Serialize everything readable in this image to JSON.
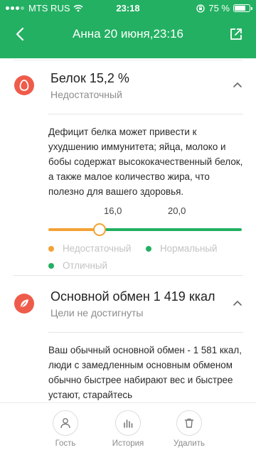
{
  "status": {
    "carrier": "MTS RUS",
    "time": "23:18",
    "battery_text": "75 %",
    "battery_level": 0.75
  },
  "nav": {
    "title": "Анна 20 июня,23:16",
    "back_icon": "chevron-left-icon",
    "share_icon": "share-icon"
  },
  "protein": {
    "title": "Белок 15,2 %",
    "status": "Недостаточный",
    "description": "Дефицит белка может привести к ухудшению иммунитета; яйца, молоко и бобы содержат высококачественный белок, а также малое количество жира, что полезно для вашего здоровья.",
    "scale_labels": [
      "16,0",
      "20,0"
    ],
    "value": 15.2,
    "legend": [
      {
        "label": "Недостаточный",
        "color": "#f3a235"
      },
      {
        "label": "Нормальный",
        "color": "#23b062"
      },
      {
        "label": "Отличный",
        "color": "#23b062"
      }
    ],
    "icon": "egg-icon"
  },
  "bmr": {
    "title": "Основной обмен 1 419 ккал",
    "status": "Цели не достигнуты",
    "description": "Ваш обычный основной обмен - 1 581 ккал, люди с замедленным основным обменом обычно быстрее набирают вес и быстрее устают, старайтесь",
    "icon": "leaf-icon"
  },
  "toolbar": {
    "guest": "Гость",
    "history": "История",
    "delete": "Удалить"
  },
  "colors": {
    "brand": "#23b062",
    "warning": "#f3a235",
    "icon_red": "#ef5b4a"
  }
}
